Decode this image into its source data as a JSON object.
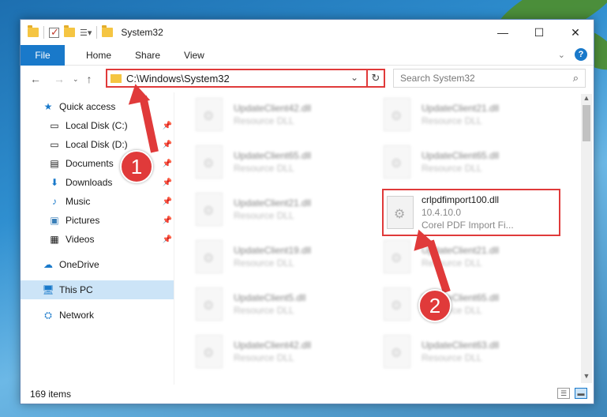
{
  "window": {
    "title": "System32"
  },
  "ribbon": {
    "file": "File",
    "tabs": [
      "Home",
      "Share",
      "View"
    ]
  },
  "nav": {
    "path": "C:\\Windows\\System32",
    "search_placeholder": "Search System32"
  },
  "sidebar": {
    "items": [
      {
        "label": "Quick access",
        "icon": "star-icon",
        "pinned": false
      },
      {
        "label": "Local Disk (C:)",
        "icon": "drive-icon",
        "pinned": true
      },
      {
        "label": "Local Disk (D:)",
        "icon": "drive-icon",
        "pinned": true
      },
      {
        "label": "Documents",
        "icon": "documents-icon",
        "pinned": true
      },
      {
        "label": "Downloads",
        "icon": "downloads-icon",
        "pinned": true
      },
      {
        "label": "Music",
        "icon": "music-icon",
        "pinned": true
      },
      {
        "label": "Pictures",
        "icon": "pictures-icon",
        "pinned": true
      },
      {
        "label": "Videos",
        "icon": "videos-icon",
        "pinned": true
      },
      {
        "label": "OneDrive",
        "icon": "cloud-icon"
      },
      {
        "label": "This PC",
        "icon": "computer-icon",
        "selected": true
      },
      {
        "label": "Network",
        "icon": "network-icon"
      }
    ]
  },
  "files": [
    {
      "name": "UpdateClient42.dll",
      "sub": "Resource DLL"
    },
    {
      "name": "UpdateClient21.dll",
      "sub": "Resource DLL"
    },
    {
      "name": "UpdateClient65.dll",
      "sub": "Resource DLL"
    },
    {
      "name": "UpdateClient65.dll",
      "sub": "Resource DLL"
    },
    {
      "name": "UpdateClient21.dll",
      "sub": "Resource DLL"
    },
    {
      "name": "crlpdfimport100.dll",
      "version": "10.4.10.0",
      "desc": "Corel PDF Import Fi..."
    },
    {
      "name": "UpdateClient19.dll",
      "sub": "Resource DLL"
    },
    {
      "name": "UpdateClient21.dll",
      "sub": "Resource DLL"
    },
    {
      "name": "UpdateClient5.dll",
      "sub": "Resource DLL"
    },
    {
      "name": "UpdateClient65.dll",
      "sub": "Resource DLL"
    },
    {
      "name": "UpdateClient42.dll",
      "sub": "Resource DLL"
    },
    {
      "name": "UpdateClient63.dll",
      "sub": "Resource DLL"
    }
  ],
  "status": {
    "count": "169 items"
  },
  "annotations": {
    "step1": "1",
    "step2": "2"
  },
  "colors": {
    "accent": "#1979ca",
    "highlight": "#e03a3a"
  }
}
